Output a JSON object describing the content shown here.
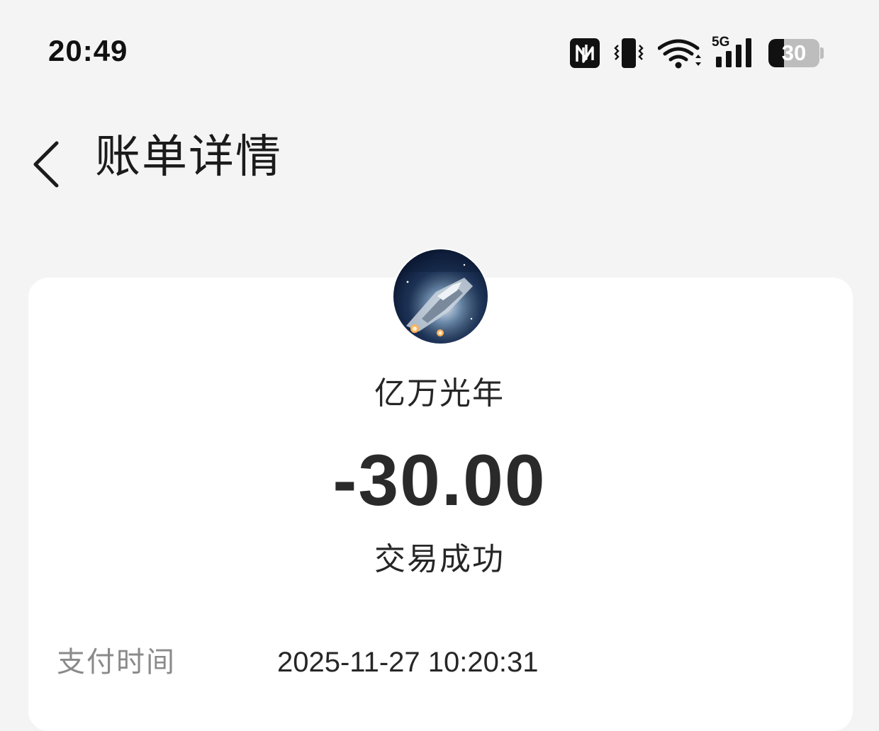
{
  "status_bar": {
    "time": "20:49",
    "network_label": "5G",
    "battery_level": "30",
    "icons": [
      "nfc-icon",
      "vibrate-icon",
      "wifi-icon",
      "cellular-5g-icon",
      "battery-icon"
    ]
  },
  "header": {
    "back_icon": "chevron-left-icon",
    "title": "账单详情"
  },
  "merchant": {
    "avatar": "game-avatar-spaceship",
    "name": "亿万光年"
  },
  "transaction": {
    "amount": "-30.00",
    "status": "交易成功"
  },
  "details": [
    {
      "label": "支付时间",
      "value": "2025-11-27 10:20:31"
    }
  ],
  "colors": {
    "page_background": "#f4f4f4",
    "card_background": "#ffffff",
    "primary_text": "#262626",
    "secondary_text": "#8a8a8a"
  }
}
